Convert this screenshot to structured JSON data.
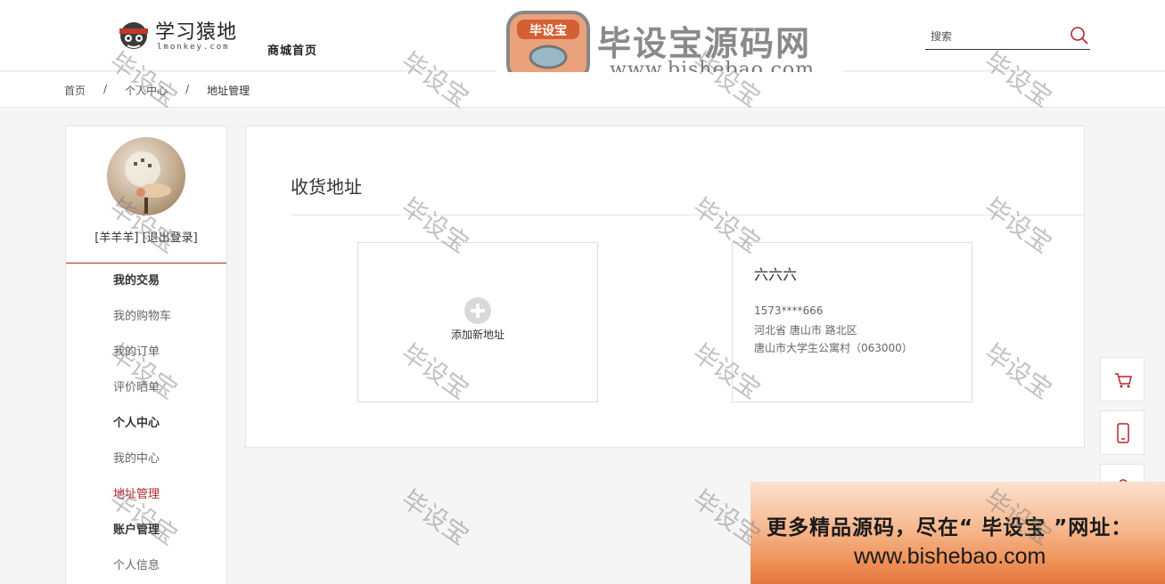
{
  "header": {
    "logo_text": "学习猿地",
    "logo_sub": "lmonkey.com",
    "logo_tag": "商城首页",
    "brand_title": "毕设宝源码网",
    "brand_url": "www.bishebao.com",
    "brand_icon_text": "毕设宝",
    "search_placeholder": "搜索"
  },
  "breadcrumb": [
    "首页",
    "个人中心",
    "地址管理"
  ],
  "breadcrumb_sep": "/",
  "user": {
    "name": "[羊羊羊]",
    "logout": "[退出登录]"
  },
  "menu": [
    {
      "type": "group",
      "label": "我的交易"
    },
    {
      "type": "item",
      "label": "我的购物车"
    },
    {
      "type": "item",
      "label": "我的订单"
    },
    {
      "type": "item",
      "label": "评价晒单"
    },
    {
      "type": "group",
      "label": "个人中心"
    },
    {
      "type": "item",
      "label": "我的中心"
    },
    {
      "type": "item",
      "label": "地址管理",
      "active": true
    },
    {
      "type": "group",
      "label": "账户管理"
    },
    {
      "type": "item",
      "label": "个人信息"
    }
  ],
  "main": {
    "title": "收货地址",
    "add_label": "添加新地址",
    "address": {
      "name": "六六六",
      "phone": "1573****666",
      "region": "河北省 唐山市 路北区",
      "detail": "唐山市大学生公寓村（063000）"
    }
  },
  "ad": {
    "line1": "更多精品源码，尽在“ 毕设宝 ”网址：",
    "line2": "www.bishebao.com"
  },
  "watermark": "毕设宝",
  "colors": {
    "accent": "#b3262d",
    "ad_gradient_top": "#fbe1cf",
    "ad_gradient_bottom": "#e27740"
  },
  "float_icons": [
    "cart-icon",
    "phone-icon",
    "user-icon"
  ]
}
